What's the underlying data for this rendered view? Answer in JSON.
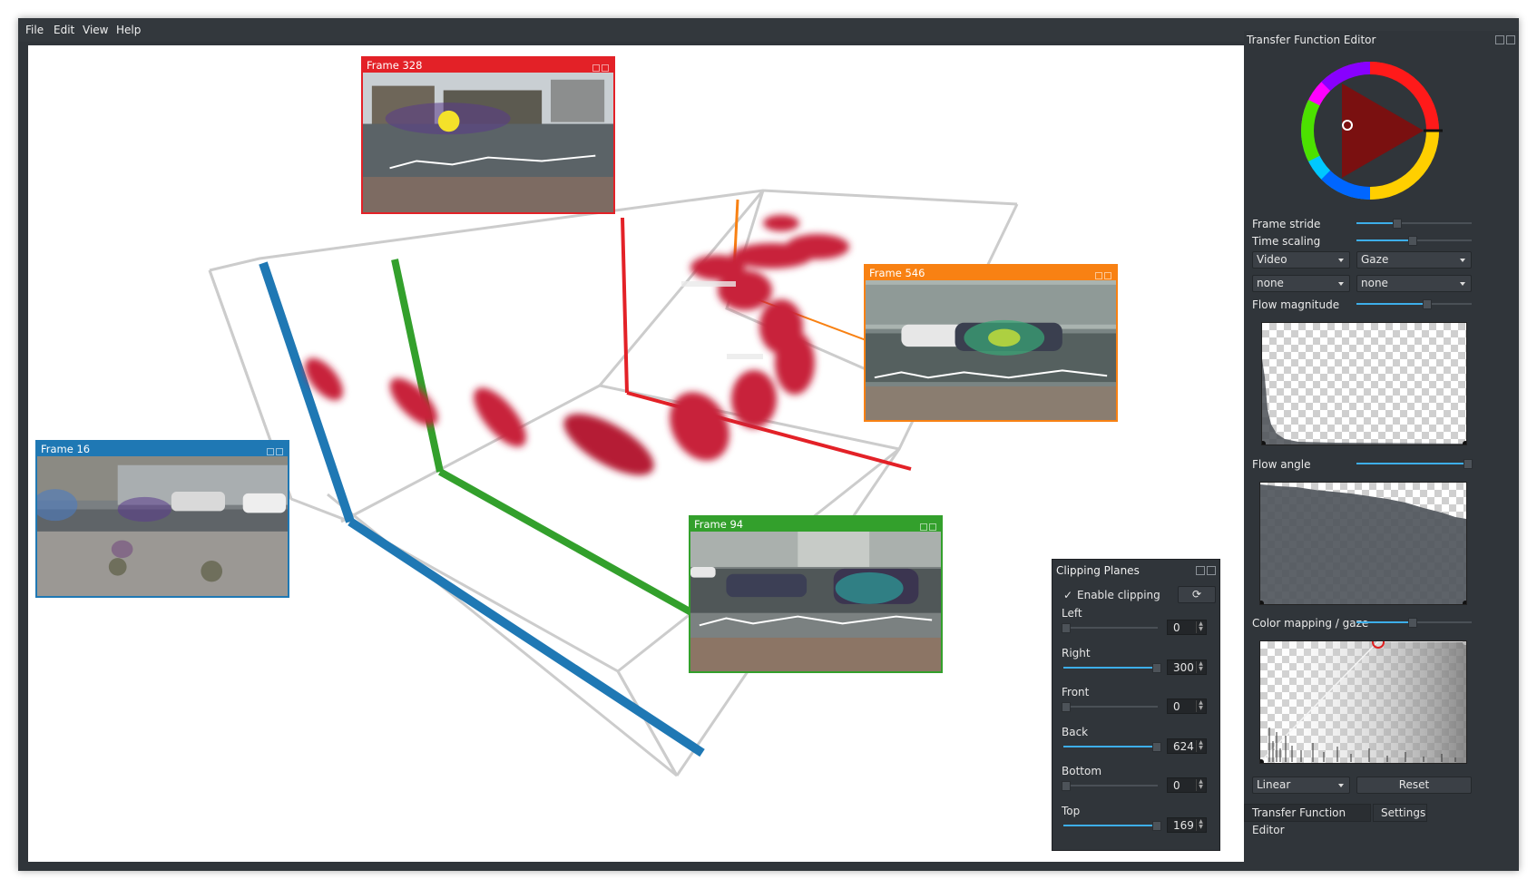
{
  "menu": [
    "File",
    "Edit",
    "View",
    "Help"
  ],
  "frames": [
    {
      "title": "Frame 328",
      "color": "#e32127"
    },
    {
      "title": "Frame 546",
      "color": "#f88113"
    },
    {
      "title": "Frame 16",
      "color": "#1f78b4"
    },
    {
      "title": "Frame 94",
      "color": "#33a02c"
    }
  ],
  "clipping": {
    "title": "Clipping Planes",
    "enable_label": "Enable clipping",
    "enabled": true,
    "check_glyph": "✓",
    "reset_icon_glyph": "⟳",
    "rows": [
      {
        "label": "Left",
        "value": "0",
        "max": 300
      },
      {
        "label": "Right",
        "value": "300",
        "max": 300
      },
      {
        "label": "Front",
        "value": "0",
        "max": 624
      },
      {
        "label": "Back",
        "value": "624",
        "max": 624
      },
      {
        "label": "Bottom",
        "value": "0",
        "max": 169
      },
      {
        "label": "Top",
        "value": "169",
        "max": 169
      }
    ]
  },
  "tf": {
    "title": "Transfer Function Editor",
    "frame_stride_label": "Frame stride",
    "frame_stride_fraction": 0.35,
    "time_scaling_label": "Time scaling",
    "time_scaling_fraction": 0.48,
    "combo1": "Video",
    "combo2": "Gaze",
    "combo3": "none",
    "combo4": "none",
    "flow_magnitude_label": "Flow magnitude",
    "flow_magnitude_fraction": 0.61,
    "flow_angle_label": "Flow angle",
    "flow_angle_fraction": 0.96,
    "color_mapping_label": "Color mapping / gaze",
    "color_mapping_fraction": 0.48,
    "interp": "Linear",
    "reset_label": "Reset"
  },
  "tabs": [
    "Transfer Function Editor",
    "Settings"
  ],
  "accent": "#3daee9"
}
